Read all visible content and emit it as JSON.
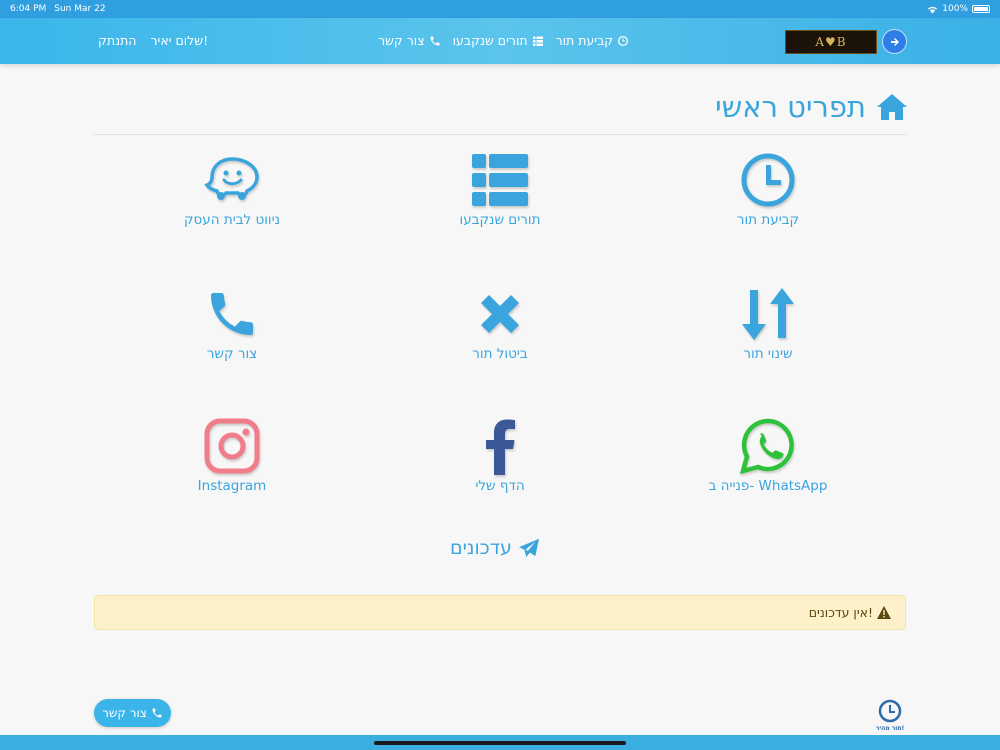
{
  "status_bar": {
    "time": "6:04 PM",
    "date": "Sun Mar 22",
    "battery": "100%"
  },
  "navbar": {
    "logout": "התנתק",
    "greeting": "שלום יאיר!",
    "contact": "צור קשר",
    "booked": "תורים שנקבעו",
    "book": "קביעת תור",
    "logo_text": "A♥B"
  },
  "page_title": "תפריט ראשי",
  "tiles": {
    "navigate": "ניווט לבית העסק",
    "booked": "תורים שנקבעו",
    "book": "קביעת תור",
    "contact": "צור קשר",
    "cancel": "ביטול תור",
    "change": "שינוי תור",
    "instagram": "Instagram",
    "facebook": "הדף שלי",
    "whatsapp": "פנייה ב- WhatsApp"
  },
  "colors": {
    "primary": "#3aa5dd",
    "instagram": "#f17c8a",
    "facebook": "#3b5998",
    "whatsapp": "#2ec23b"
  },
  "updates": {
    "title": "עדכונים",
    "empty_message": "אין עדכונים!"
  },
  "floating": {
    "contact": "צור קשר",
    "logo_caption": "תור מהיר!"
  }
}
